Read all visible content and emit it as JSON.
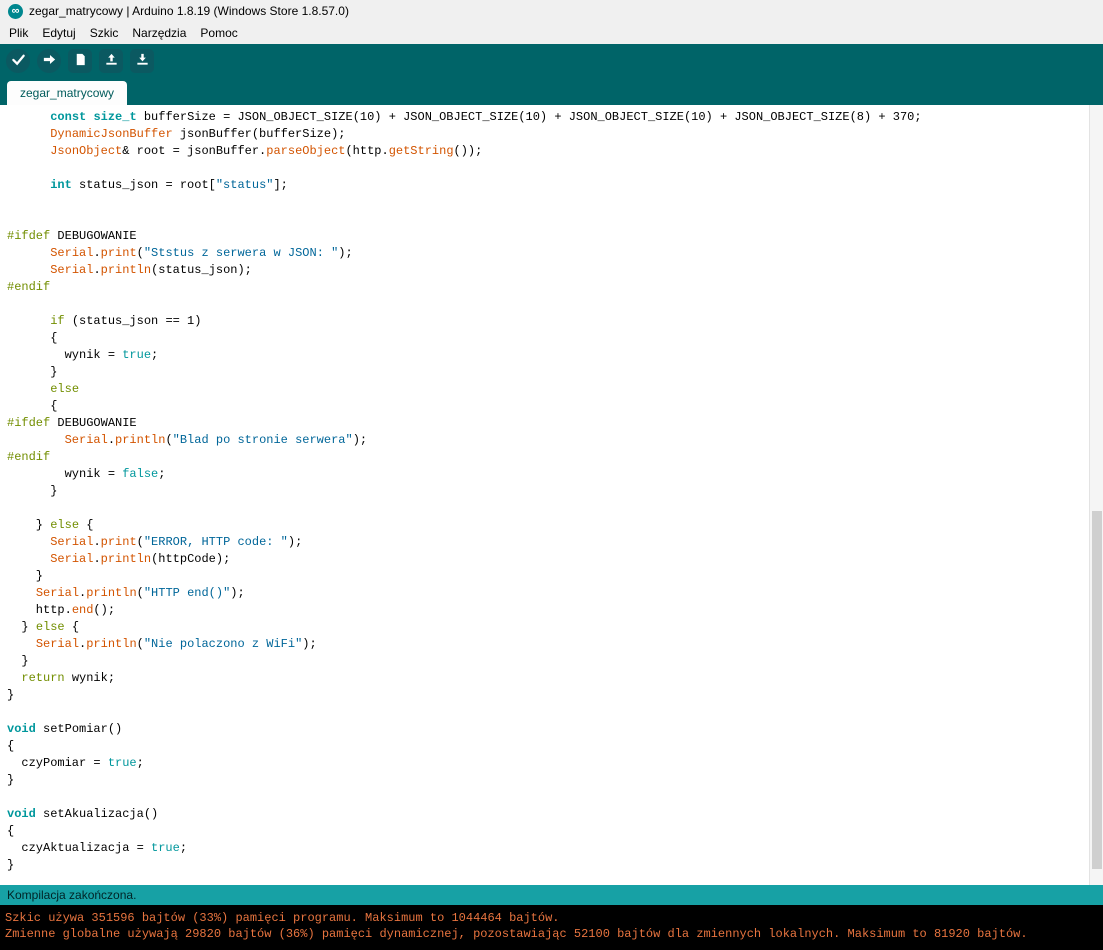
{
  "window": {
    "title": "zegar_matrycowy | Arduino 1.8.19 (Windows Store 1.8.57.0)",
    "app_icon": "arduino-infinity-icon",
    "app_icon_glyph": "∞"
  },
  "menu": {
    "items": [
      "Plik",
      "Edytuj",
      "Szkic",
      "Narzędzia",
      "Pomoc"
    ]
  },
  "toolbar": {
    "buttons": [
      {
        "name": "verify",
        "icon": "check-icon"
      },
      {
        "name": "upload",
        "icon": "arrow-right-icon"
      },
      {
        "name": "new-sketch",
        "icon": "document-icon"
      },
      {
        "name": "open",
        "icon": "arrow-up-icon"
      },
      {
        "name": "save",
        "icon": "arrow-down-icon"
      }
    ]
  },
  "tabs": {
    "active": "zegar_matrycowy"
  },
  "editor": {
    "lines": [
      [
        [
          "p",
          "      "
        ],
        [
          "k",
          "const"
        ],
        [
          "p",
          " "
        ],
        [
          "k",
          "size_t"
        ],
        [
          "p",
          " bufferSize = JSON_OBJECT_SIZE(10) + JSON_OBJECT_SIZE(10) + JSON_OBJECT_SIZE(10) + JSON_OBJECT_SIZE(8) + 370;"
        ]
      ],
      [
        [
          "p",
          "      "
        ],
        [
          "f",
          "DynamicJsonBuffer"
        ],
        [
          "p",
          " jsonBuffer(bufferSize);"
        ]
      ],
      [
        [
          "p",
          "      "
        ],
        [
          "f",
          "JsonObject"
        ],
        [
          "p",
          "& root = jsonBuffer."
        ],
        [
          "f",
          "parseObject"
        ],
        [
          "p",
          "(http."
        ],
        [
          "f",
          "getString"
        ],
        [
          "p",
          "());"
        ]
      ],
      [],
      [
        [
          "p",
          "      "
        ],
        [
          "k",
          "int"
        ],
        [
          "p",
          " status_json = root["
        ],
        [
          "s",
          "\"status\""
        ],
        [
          "p",
          "];"
        ]
      ],
      [],
      [],
      [
        [
          "c",
          "#ifdef"
        ],
        [
          "p",
          " DEBUGOWANIE"
        ]
      ],
      [
        [
          "p",
          "      "
        ],
        [
          "f",
          "Serial"
        ],
        [
          "p",
          "."
        ],
        [
          "f",
          "print"
        ],
        [
          "p",
          "("
        ],
        [
          "s",
          "\"Ststus z serwera w JSON: \""
        ],
        [
          "p",
          ");"
        ]
      ],
      [
        [
          "p",
          "      "
        ],
        [
          "f",
          "Serial"
        ],
        [
          "p",
          "."
        ],
        [
          "f",
          "println"
        ],
        [
          "p",
          "(status_json);"
        ]
      ],
      [
        [
          "c",
          "#endif"
        ]
      ],
      [],
      [
        [
          "p",
          "      "
        ],
        [
          "c",
          "if"
        ],
        [
          "p",
          " (status_json == 1)"
        ]
      ],
      [
        [
          "p",
          "      {"
        ]
      ],
      [
        [
          "p",
          "        wynik = "
        ],
        [
          "l",
          "true"
        ],
        [
          "p",
          ";"
        ]
      ],
      [
        [
          "p",
          "      }"
        ]
      ],
      [
        [
          "p",
          "      "
        ],
        [
          "c",
          "else"
        ]
      ],
      [
        [
          "p",
          "      {"
        ]
      ],
      [
        [
          "c",
          "#ifdef"
        ],
        [
          "p",
          " DEBUGOWANIE"
        ]
      ],
      [
        [
          "p",
          "        "
        ],
        [
          "f",
          "Serial"
        ],
        [
          "p",
          "."
        ],
        [
          "f",
          "println"
        ],
        [
          "p",
          "("
        ],
        [
          "s",
          "\"Blad po stronie serwera\""
        ],
        [
          "p",
          ");"
        ]
      ],
      [
        [
          "c",
          "#endif"
        ]
      ],
      [
        [
          "p",
          "        wynik = "
        ],
        [
          "l",
          "false"
        ],
        [
          "p",
          ";"
        ]
      ],
      [
        [
          "p",
          "      }"
        ]
      ],
      [],
      [
        [
          "p",
          "    } "
        ],
        [
          "c",
          "else"
        ],
        [
          "p",
          " {"
        ]
      ],
      [
        [
          "p",
          "      "
        ],
        [
          "f",
          "Serial"
        ],
        [
          "p",
          "."
        ],
        [
          "f",
          "print"
        ],
        [
          "p",
          "("
        ],
        [
          "s",
          "\"ERROR, HTTP code: \""
        ],
        [
          "p",
          ");"
        ]
      ],
      [
        [
          "p",
          "      "
        ],
        [
          "f",
          "Serial"
        ],
        [
          "p",
          "."
        ],
        [
          "f",
          "println"
        ],
        [
          "p",
          "(httpCode);"
        ]
      ],
      [
        [
          "p",
          "    }"
        ]
      ],
      [
        [
          "p",
          "    "
        ],
        [
          "f",
          "Serial"
        ],
        [
          "p",
          "."
        ],
        [
          "f",
          "println"
        ],
        [
          "p",
          "("
        ],
        [
          "s",
          "\"HTTP end()\""
        ],
        [
          "p",
          ");"
        ]
      ],
      [
        [
          "p",
          "    http."
        ],
        [
          "f",
          "end"
        ],
        [
          "p",
          "();"
        ]
      ],
      [
        [
          "p",
          "  } "
        ],
        [
          "c",
          "else"
        ],
        [
          "p",
          " {"
        ]
      ],
      [
        [
          "p",
          "    "
        ],
        [
          "f",
          "Serial"
        ],
        [
          "p",
          "."
        ],
        [
          "f",
          "println"
        ],
        [
          "p",
          "("
        ],
        [
          "s",
          "\"Nie polaczono z WiFi\""
        ],
        [
          "p",
          ");"
        ]
      ],
      [
        [
          "p",
          "  }"
        ]
      ],
      [
        [
          "p",
          "  "
        ],
        [
          "c",
          "return"
        ],
        [
          "p",
          " wynik;"
        ]
      ],
      [
        [
          "p",
          "}"
        ]
      ],
      [],
      [
        [
          "k",
          "void"
        ],
        [
          "p",
          " setPomiar()"
        ]
      ],
      [
        [
          "p",
          "{"
        ]
      ],
      [
        [
          "p",
          "  czyPomiar = "
        ],
        [
          "l",
          "true"
        ],
        [
          "p",
          ";"
        ]
      ],
      [
        [
          "p",
          "}"
        ]
      ],
      [],
      [
        [
          "k",
          "void"
        ],
        [
          "p",
          " setAkualizacja()"
        ]
      ],
      [
        [
          "p",
          "{"
        ]
      ],
      [
        [
          "p",
          "  czyAktualizacja = "
        ],
        [
          "l",
          "true"
        ],
        [
          "p",
          ";"
        ]
      ],
      [
        [
          "p",
          "}"
        ]
      ]
    ]
  },
  "status_bar": {
    "text": "Kompilacja zakończona."
  },
  "console": {
    "lines": [
      "Szkic używa 351596 bajtów (33%) pamięci programu. Maksimum to 1044464 bajtów.",
      "Zmienne globalne używają 29820 bajtów (36%) pamięci dynamicznej, pozostawiając 52100 bajtów dla zmiennych lokalnych. Maksimum to 81920 bajtów."
    ]
  },
  "colors": {
    "header_teal": "#006468",
    "button_teal": "#0b5961",
    "status_bar_bg": "#17A1A5",
    "status_bar_text": "#002325",
    "tab_text": "#005B5B",
    "console_bg": "#000000",
    "console_text": "#E8743F",
    "syntax": {
      "plain": "#000000",
      "type_keyword": "#00979C",
      "function": "#D35400",
      "string": "#006699",
      "reserved_word": "#728E00",
      "literal": "#00979C"
    }
  }
}
